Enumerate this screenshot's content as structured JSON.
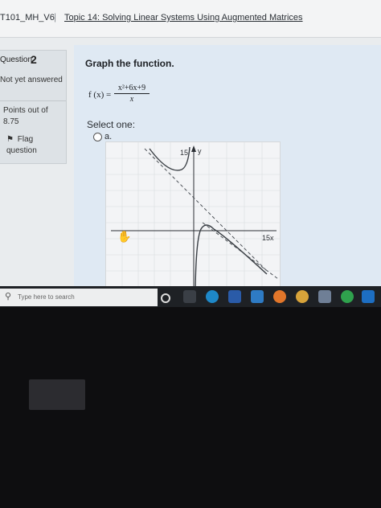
{
  "header": {
    "course": "T101_MH_V6",
    "separator": "|",
    "topic": "Topic 14: Solving Linear Systems Using Augmented Matrices"
  },
  "question_info": {
    "label": "Question",
    "number": "2",
    "status": "Not yet answered",
    "points": "Points out of 8.75",
    "flag_label": "Flag question"
  },
  "question": {
    "prompt": "Graph the function.",
    "function_lhs": "f (x) =",
    "numerator": "x²+6x+9",
    "denominator": "x",
    "select_label": "Select one:",
    "option_a": "a."
  },
  "graph": {
    "y_label": "y",
    "y_tick": "15",
    "x_tick": "15x"
  },
  "taskbar": {
    "search_placeholder": "Type here to search",
    "icons": [
      "task-view-icon",
      "edge-browser-icon",
      "word-icon",
      "mail-icon",
      "firefox-icon",
      "chrome-icon",
      "file-explorer-icon",
      "spotify-icon",
      "outlook-icon"
    ]
  },
  "colors": {
    "page_bg": "#e9ecee",
    "content_bg": "#dfe9f3",
    "taskbar": "#1e2125",
    "curve": "#3a3f45"
  }
}
